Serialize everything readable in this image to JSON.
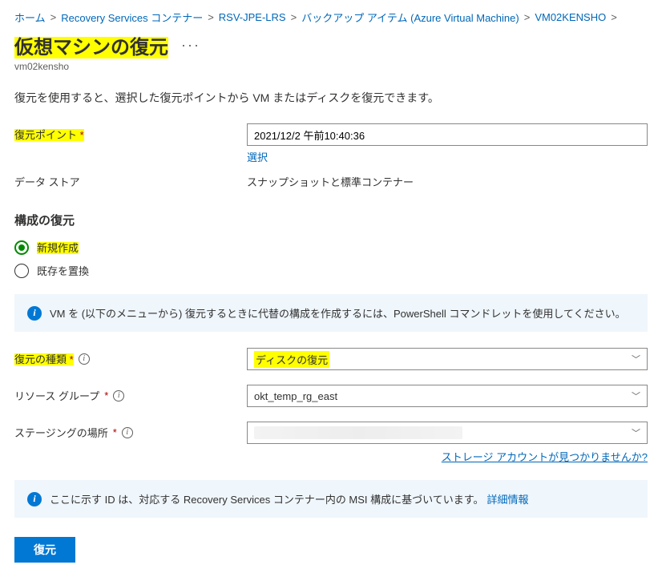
{
  "breadcrumb": {
    "home": "ホーム",
    "rsv_containers": "Recovery Services コンテナー",
    "rsv_name": "RSV-JPE-LRS",
    "backup_items": "バックアップ アイテム (Azure Virtual Machine)",
    "vm_name": "VM02KENSHO",
    "sep": ">"
  },
  "header": {
    "title": "仮想マシンの復元",
    "more": "···",
    "subtitle": "vm02kensho"
  },
  "description": "復元を使用すると、選択した復元ポイントから VM またはディスクを復元できます。",
  "restore_point": {
    "label": "復元ポイント",
    "value": "2021/12/2 午前10:40:36",
    "select_link": "選択"
  },
  "data_store": {
    "label": "データ ストア",
    "value": "スナップショットと標準コンテナー"
  },
  "config_restore": {
    "header": "構成の復元",
    "option_new": "新規作成",
    "option_replace": "既存を置換"
  },
  "info_powershell": "VM を (以下のメニューから) 復元するときに代替の構成を作成するには、PowerShell コマンドレットを使用してください。",
  "restore_type": {
    "label": "復元の種類",
    "value": "ディスクの復元"
  },
  "resource_group": {
    "label": "リソース グループ",
    "value": "okt_temp_rg_east"
  },
  "staging": {
    "label": "ステージングの場所",
    "help_link": "ストレージ アカウントが見つかりませんか?"
  },
  "info_msi": {
    "text": "ここに示す ID は、対応する Recovery Services コンテナー内の MSI 構成に基づいています。",
    "details": "詳細情報"
  },
  "restore_button": "復元"
}
